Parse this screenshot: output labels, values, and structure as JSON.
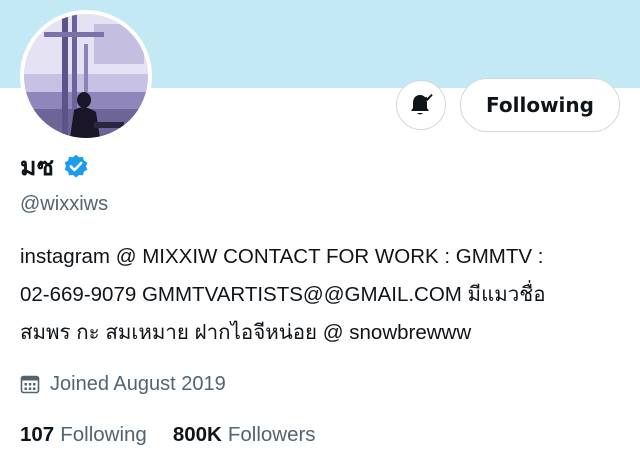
{
  "profile": {
    "display_name": "มซ",
    "handle": "@wixxiws",
    "bio_lines": [
      "instagram @ MIXXIW CONTACT FOR WORK : GMMTV :",
      "02-669-9079 GMMTVARTISTS@@GMAIL.COM มีแมวชื่อ",
      "สมพร กะ สมเหมาย ฝากไอจีหน่อย @ snowbrewww"
    ],
    "joined": "Joined August 2019",
    "verified": true
  },
  "actions": {
    "following_label": "Following",
    "bell_icon": "bell-check-icon"
  },
  "stats": {
    "following_count": "107",
    "following_label": "Following",
    "followers_count": "800K",
    "followers_label": "Followers"
  },
  "colors": {
    "banner": "#c3eaf4",
    "verified_blue": "#1d9bf0",
    "secondary_text": "#536471",
    "border": "#cfd9de"
  }
}
